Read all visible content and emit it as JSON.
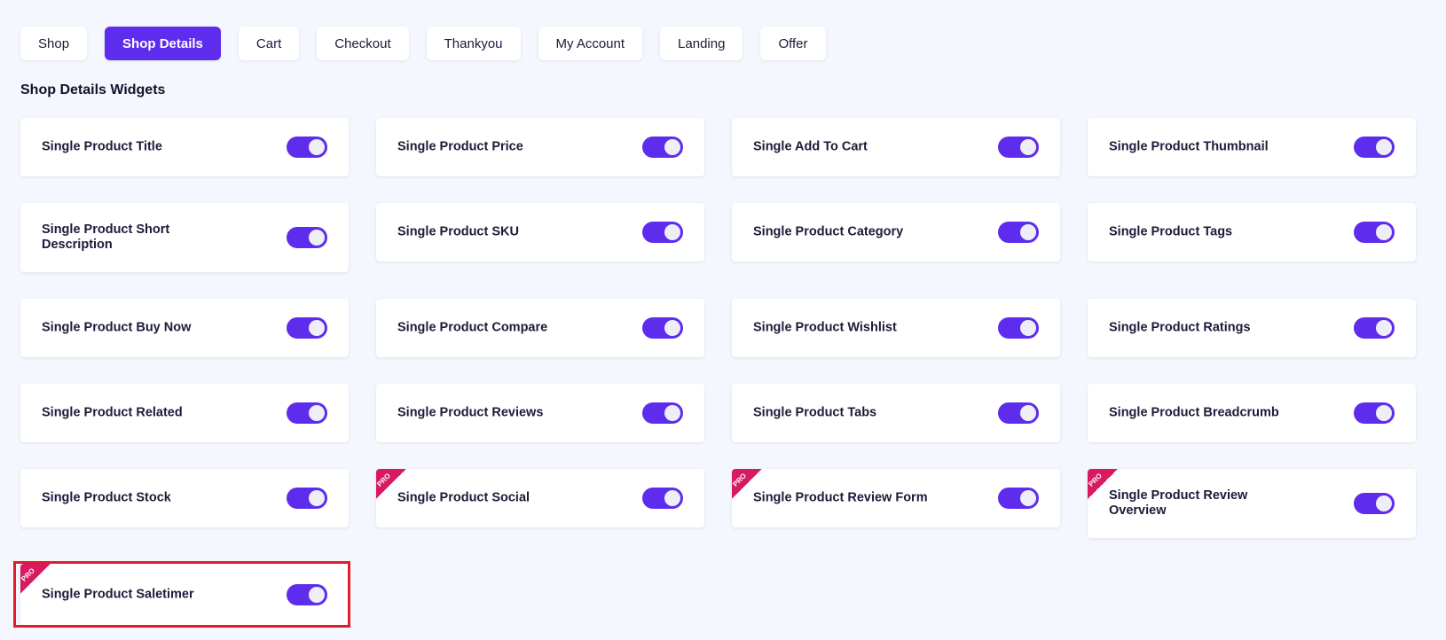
{
  "tabs": [
    {
      "label": "Shop",
      "active": false
    },
    {
      "label": "Shop Details",
      "active": true
    },
    {
      "label": "Cart",
      "active": false
    },
    {
      "label": "Checkout",
      "active": false
    },
    {
      "label": "Thankyou",
      "active": false
    },
    {
      "label": "My Account",
      "active": false
    },
    {
      "label": "Landing",
      "active": false
    },
    {
      "label": "Offer",
      "active": false
    }
  ],
  "section_title": "Shop Details Widgets",
  "pro_badge": "PRO",
  "colors": {
    "accent": "#5e2ced",
    "pro": "#d81b60",
    "highlight": "#e11d2c"
  },
  "widgets": [
    {
      "label": "Single Product Title",
      "enabled": true,
      "pro": false
    },
    {
      "label": "Single Product Price",
      "enabled": true,
      "pro": false
    },
    {
      "label": "Single Add To Cart",
      "enabled": true,
      "pro": false
    },
    {
      "label": "Single Product Thumbnail",
      "enabled": true,
      "pro": false
    },
    {
      "label": "Single Product Short Description",
      "enabled": true,
      "pro": false
    },
    {
      "label": "Single Product SKU",
      "enabled": true,
      "pro": false
    },
    {
      "label": "Single Product Category",
      "enabled": true,
      "pro": false
    },
    {
      "label": "Single Product Tags",
      "enabled": true,
      "pro": false
    },
    {
      "label": "Single Product Buy Now",
      "enabled": true,
      "pro": false
    },
    {
      "label": "Single Product Compare",
      "enabled": true,
      "pro": false
    },
    {
      "label": "Single Product Wishlist",
      "enabled": true,
      "pro": false
    },
    {
      "label": "Single Product Ratings",
      "enabled": true,
      "pro": false
    },
    {
      "label": "Single Product Related",
      "enabled": true,
      "pro": false
    },
    {
      "label": "Single Product Reviews",
      "enabled": true,
      "pro": false
    },
    {
      "label": "Single Product Tabs",
      "enabled": true,
      "pro": false
    },
    {
      "label": "Single Product Breadcrumb",
      "enabled": true,
      "pro": false
    },
    {
      "label": "Single Product Stock",
      "enabled": true,
      "pro": false
    },
    {
      "label": "Single Product Social",
      "enabled": true,
      "pro": true
    },
    {
      "label": "Single Product Review Form",
      "enabled": true,
      "pro": true
    },
    {
      "label": "Single Product Review Overview",
      "enabled": true,
      "pro": true
    },
    {
      "label": "Single Product Saletimer",
      "enabled": true,
      "pro": true
    }
  ]
}
